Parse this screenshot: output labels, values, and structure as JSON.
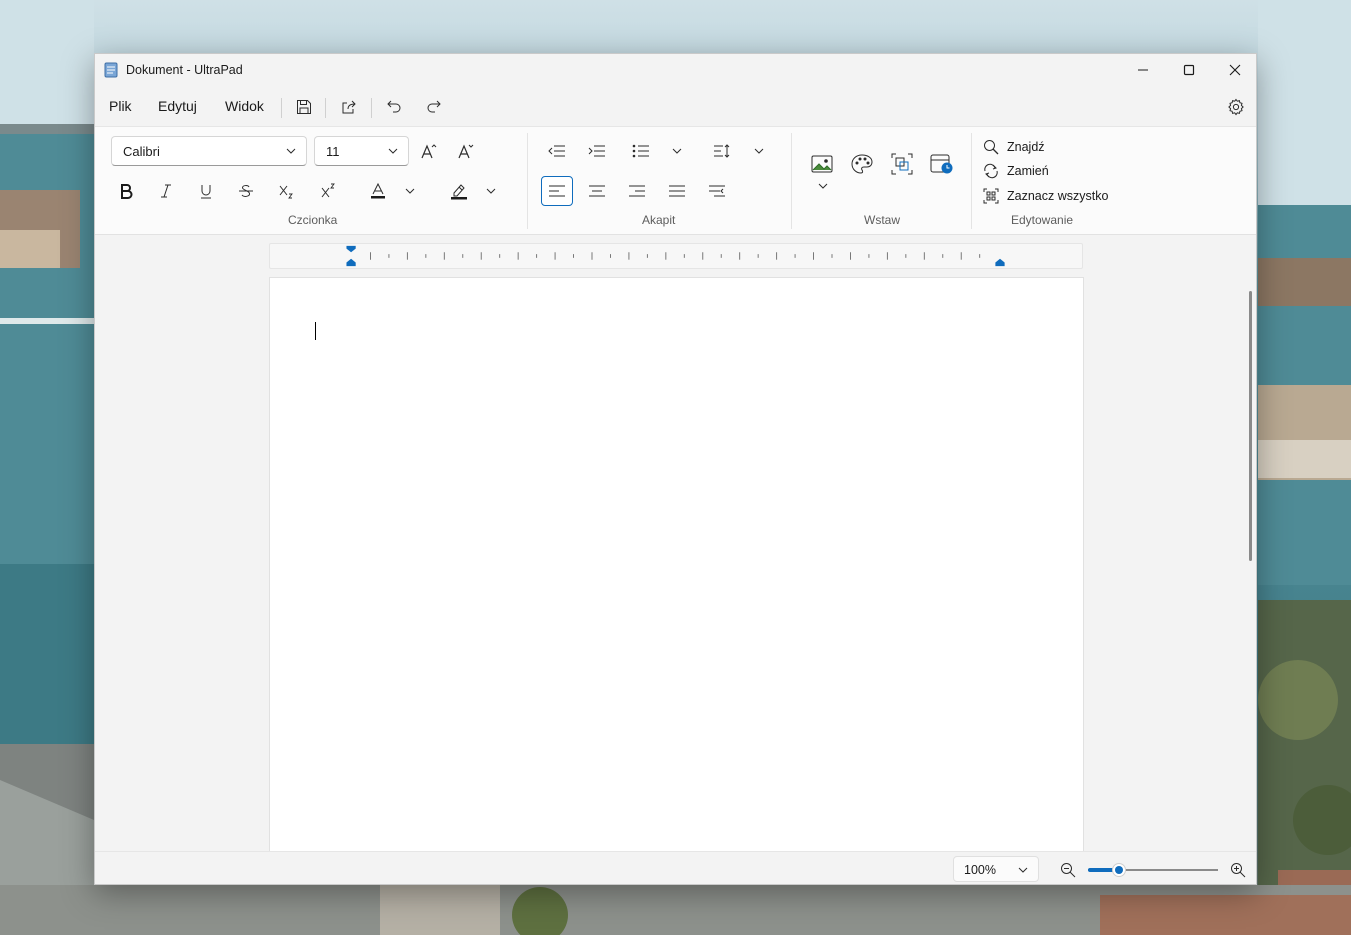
{
  "window": {
    "title": "Dokument - UltraPad"
  },
  "menu": {
    "file": "Plik",
    "edit": "Edytuj",
    "view": "Widok"
  },
  "ribbon": {
    "font": {
      "family": "Calibri",
      "size": "11",
      "group_label": "Czcionka"
    },
    "paragraph": {
      "group_label": "Akapit",
      "active_alignment": "align-left"
    },
    "insert": {
      "group_label": "Wstaw"
    },
    "editing": {
      "group_label": "Edytowanie",
      "find": "Znajdź",
      "replace": "Zamień",
      "select_all": "Zaznacz wszystko"
    }
  },
  "status": {
    "zoom": "100%",
    "zoom_slider_fraction": 0.24
  },
  "colors": {
    "accent": "#0f6cbd"
  },
  "icons": [
    "notepad-icon",
    "minimize-icon",
    "maximize-icon",
    "close-icon",
    "save-icon",
    "share-icon",
    "undo-icon",
    "redo-icon",
    "settings-icon",
    "grow-font-icon",
    "shrink-font-icon",
    "bold-icon",
    "italic-icon",
    "underline-icon",
    "strikethrough-icon",
    "subscript-icon",
    "superscript-icon",
    "font-color-icon",
    "highlight-icon",
    "decrease-indent-icon",
    "increase-indent-icon",
    "bullets-icon",
    "line-spacing-icon",
    "align-left-icon",
    "align-center-icon",
    "align-right-icon",
    "justify-icon",
    "rtl-icon",
    "picture-icon",
    "paint-icon",
    "object-icon",
    "datetime-icon",
    "search-icon",
    "replace-icon",
    "select-all-icon",
    "zoom-out-icon",
    "zoom-in-icon"
  ]
}
